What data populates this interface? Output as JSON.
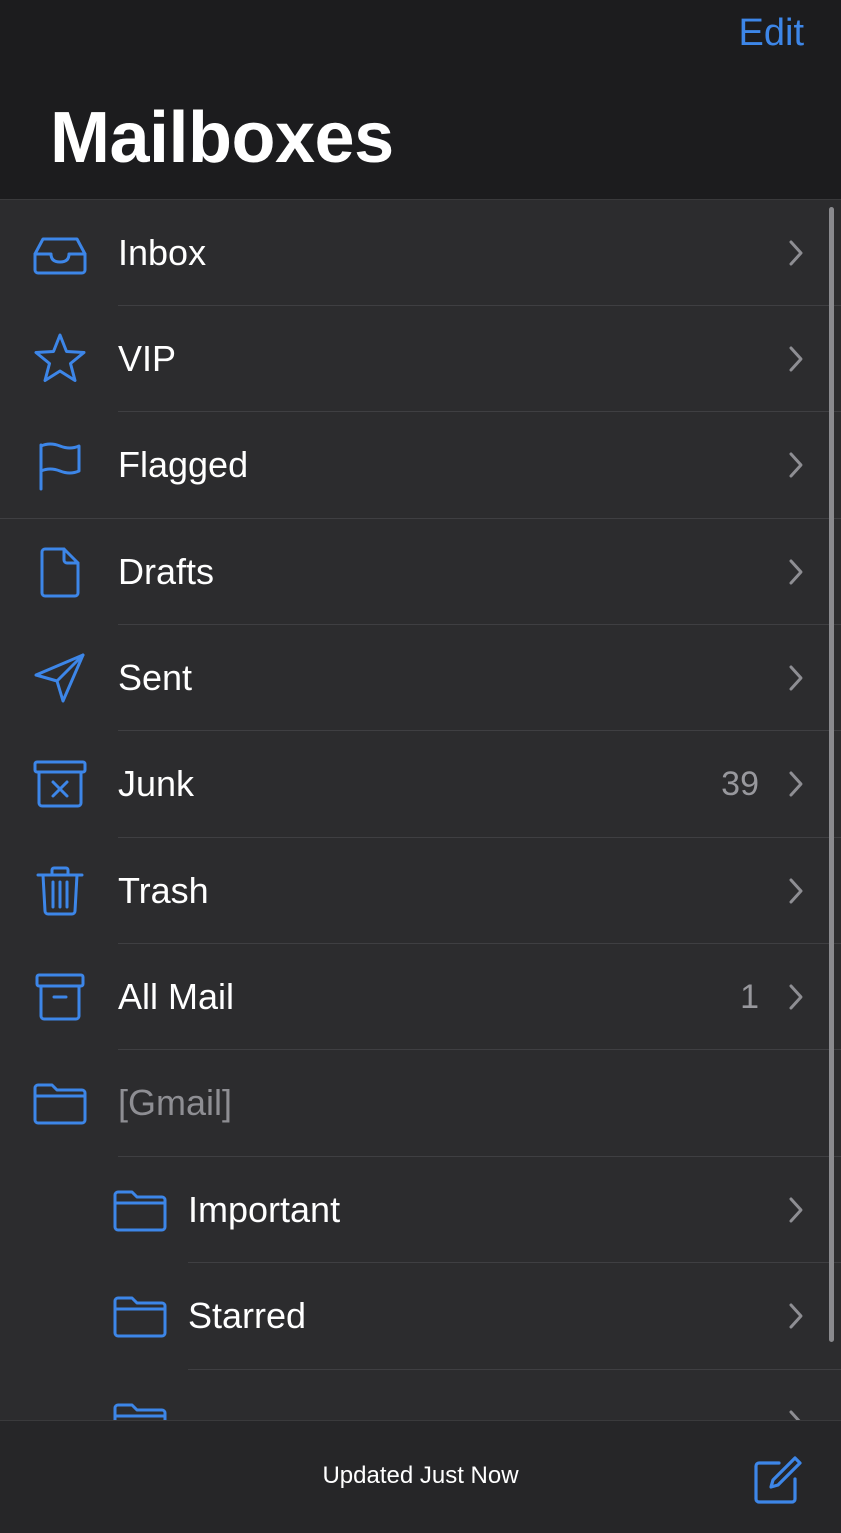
{
  "header": {
    "edit_label": "Edit",
    "title": "Mailboxes"
  },
  "mailboxes": [
    {
      "label": "Inbox",
      "icon": "tray-icon",
      "count": ""
    },
    {
      "label": "VIP",
      "icon": "star-icon",
      "count": ""
    },
    {
      "label": "Flagged",
      "icon": "flag-icon",
      "count": ""
    },
    {
      "label": "Drafts",
      "icon": "document-icon",
      "count": ""
    },
    {
      "label": "Sent",
      "icon": "paperplane-icon",
      "count": ""
    },
    {
      "label": "Junk",
      "icon": "junk-bin-icon",
      "count": "39"
    },
    {
      "label": "Trash",
      "icon": "trash-icon",
      "count": ""
    },
    {
      "label": "All Mail",
      "icon": "archive-box-icon",
      "count": "1"
    },
    {
      "label": "[Gmail]",
      "icon": "folder-icon",
      "count": ""
    },
    {
      "label": "Important",
      "icon": "folder-icon",
      "count": ""
    },
    {
      "label": "Starred",
      "icon": "folder-icon",
      "count": ""
    }
  ],
  "toolbar": {
    "status": "Updated Just Now",
    "compose_icon": "compose-icon"
  },
  "colors": {
    "accent": "#3d86e8",
    "background": "#2c2c2e",
    "header_bg": "#1c1c1e"
  }
}
